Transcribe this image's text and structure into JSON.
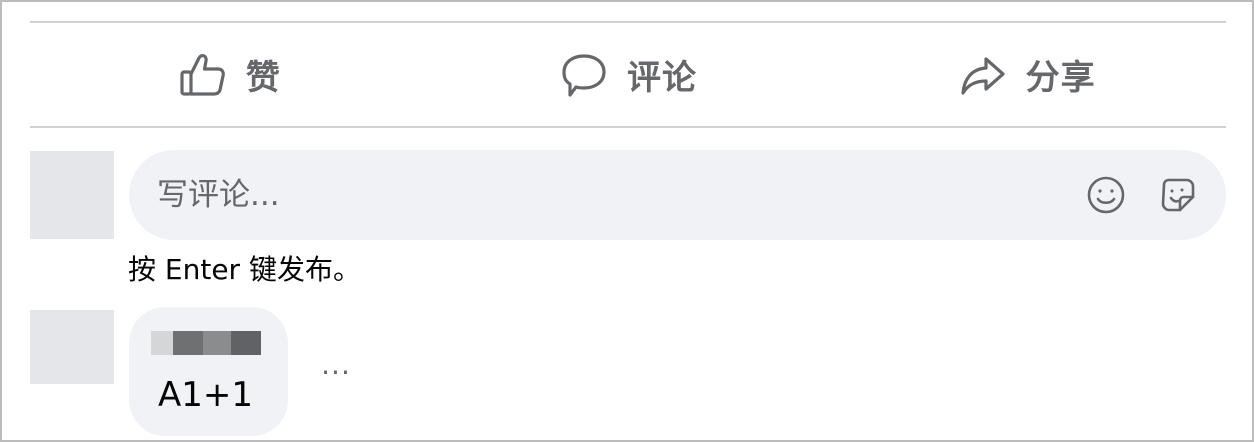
{
  "actions": {
    "like": {
      "label": "赞",
      "icon": "thumbs-up-icon"
    },
    "comment": {
      "label": "评论",
      "icon": "speech-bubble-icon"
    },
    "share": {
      "label": "分享",
      "icon": "share-arrow-icon"
    }
  },
  "composer": {
    "placeholder": "写评论...",
    "icons": [
      "smiley-icon",
      "sticker-icon"
    ],
    "hint": "按 Enter 键发布。"
  },
  "comments": [
    {
      "author_name_visible": false,
      "text": "A1+1",
      "more_label": "···"
    }
  ],
  "colors": {
    "icon_gray": "#65676b",
    "bubble_bg": "#f0f2f5",
    "divider": "#ced0d4",
    "avatar_placeholder": "#e4e6e9"
  }
}
